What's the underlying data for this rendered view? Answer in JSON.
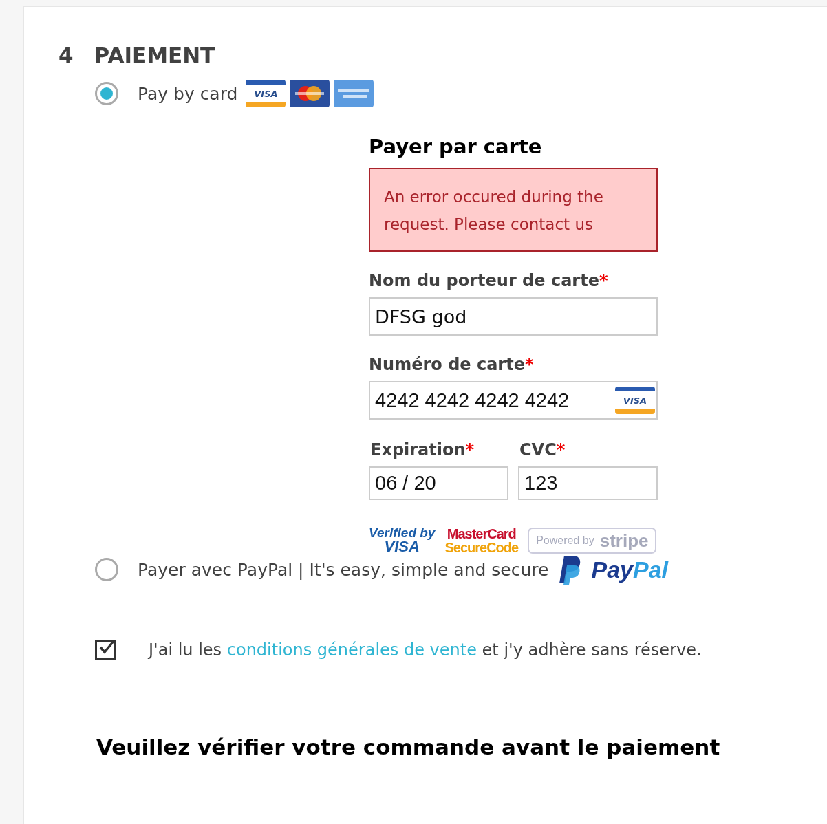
{
  "section": {
    "number": "4",
    "title": "PAIEMENT"
  },
  "card_option": {
    "label": "Pay by card",
    "selected": true,
    "card_logos": [
      {
        "kind": "visa",
        "text": "VISA"
      },
      {
        "kind": "mastercard"
      },
      {
        "kind": "amex"
      }
    ]
  },
  "card_form": {
    "title": "Payer par carte",
    "error": "An error occured during the request. Please contact us",
    "fields": [
      {
        "kind": "full",
        "label": "Nom du porteur de carte",
        "required_mark": "*",
        "value": "DFSG god"
      },
      {
        "kind": "card",
        "label": "Numéro de carte",
        "required_mark": "*",
        "value": "4242 4242 4242 4242",
        "brand": "VISA"
      },
      {
        "kind": "half",
        "label": "Expiration",
        "required_mark": "*",
        "value": "06 / 20"
      },
      {
        "kind": "half",
        "label": "CVC",
        "required_mark": "*",
        "value": "123"
      }
    ],
    "badges": [
      {
        "kind": "verified",
        "lines": [
          "Verified by",
          "VISA"
        ]
      },
      {
        "kind": "securecode",
        "lines": [
          "MasterCard",
          "SecureCode"
        ]
      },
      {
        "kind": "stripe",
        "lines": [
          "Powered by",
          "stripe"
        ]
      }
    ]
  },
  "paypal_option": {
    "label": "Payer avec PayPal | It's easy, simple and secure",
    "selected": false,
    "logo_text": [
      "Pay",
      "Pal"
    ]
  },
  "terms": {
    "checked": true,
    "before": "J'ai lu les ",
    "link": "conditions générales de vente",
    "after": " et j'y adhère sans réserve."
  },
  "review_heading": "Veuillez vérifier votre commande avant le paiement"
}
